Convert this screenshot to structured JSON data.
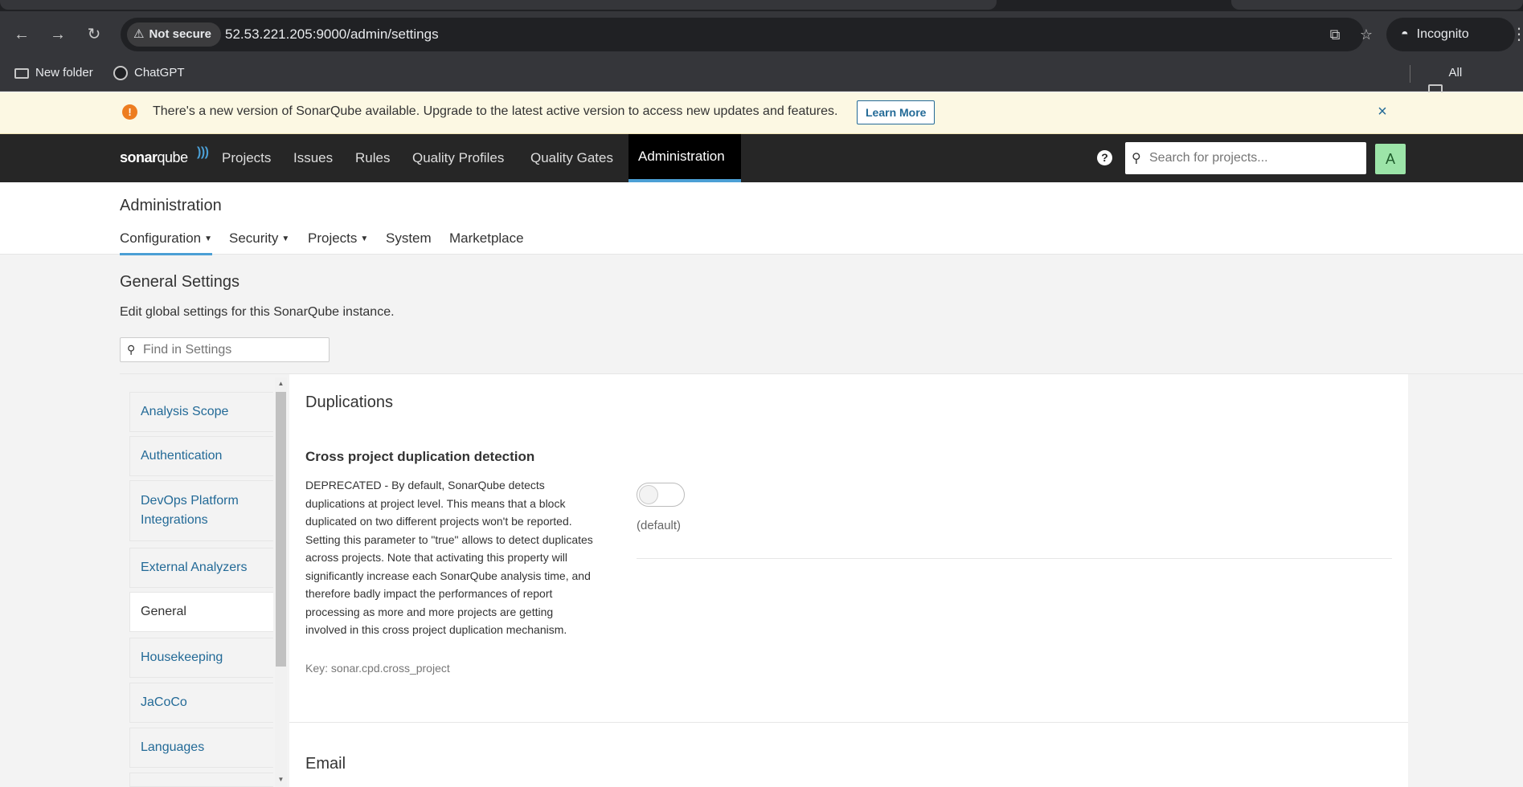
{
  "browser": {
    "security_chip": "Not secure",
    "url": "52.53.221.205:9000/admin/settings",
    "incognito_label": "Incognito",
    "bookmarks": [
      {
        "label": "New folder"
      },
      {
        "label": "ChatGPT"
      },
      {
        "label": "All Bookmarks"
      }
    ]
  },
  "banner": {
    "message": "There's a new version of SonarQube available. Upgrade to the latest active version to access new updates and features.",
    "learn_more": "Learn More",
    "close": "×"
  },
  "topnav": {
    "logo_bold": "sonar",
    "logo_light": "qube",
    "items": [
      {
        "label": "Projects"
      },
      {
        "label": "Issues"
      },
      {
        "label": "Rules"
      },
      {
        "label": "Quality Profiles"
      },
      {
        "label": "Quality Gates"
      },
      {
        "label": "Administration"
      }
    ],
    "search_placeholder": "Search for projects...",
    "avatar_initial": "A"
  },
  "admin": {
    "title": "Administration",
    "subnav": [
      {
        "label": "Configuration"
      },
      {
        "label": "Security"
      },
      {
        "label": "Projects"
      },
      {
        "label": "System"
      },
      {
        "label": "Marketplace"
      }
    ]
  },
  "settings": {
    "title": "General Settings",
    "description": "Edit global settings for this SonarQube instance.",
    "find_placeholder": "Find in Settings",
    "categories": [
      {
        "label": "Analysis Scope"
      },
      {
        "label": "Authentication"
      },
      {
        "label": "DevOps Platform Integrations"
      },
      {
        "label": "External Analyzers"
      },
      {
        "label": "General"
      },
      {
        "label": "Housekeeping"
      },
      {
        "label": "JaCoCo"
      },
      {
        "label": "Languages"
      }
    ],
    "active_category": "General",
    "sections": [
      {
        "title": "Duplications",
        "property": {
          "name": "Cross project duplication detection",
          "description": "DEPRECATED - By default, SonarQube detects duplications at project level. This means that a block duplicated on two different projects won't be reported. Setting this parameter to \"true\" allows to detect duplicates across projects. Note that activating this property will significantly increase each SonarQube analysis time, and therefore badly impact the performances of report processing as more and more projects are getting involved in this cross project duplication mechanism.",
          "key": "Key: sonar.cpd.cross_project",
          "value": false,
          "default_label": "(default)"
        }
      },
      {
        "title": "Email"
      }
    ]
  },
  "colors": {
    "accent": "#4b9fd5",
    "link": "#236a97",
    "nav_bg": "#262626",
    "banner_bg": "#fcf8e3",
    "warning": "#ed7d20",
    "avatar_bg": "#9ce4a8"
  }
}
